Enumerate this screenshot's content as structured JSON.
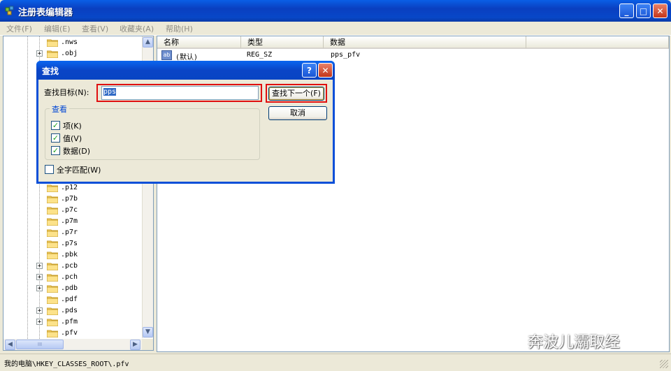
{
  "window": {
    "title": "注册表编辑器"
  },
  "menu": [
    "文件(F)",
    "编辑(E)",
    "查看(V)",
    "收藏夹(A)",
    "帮助(H)"
  ],
  "tree": {
    "top_items": [
      ".nws",
      ".obj"
    ],
    "bottom_items": [
      ".p12",
      ".p7b",
      ".p7c",
      ".p7m",
      ".p7r",
      ".p7s",
      ".pbk",
      ".pcb",
      ".pch",
      ".pdb",
      ".pdf",
      ".pds",
      ".pfm",
      ".pfv"
    ],
    "expandable": [
      ".obj",
      ".pcb",
      ".pch",
      ".pdb",
      ".pds",
      ".pfm"
    ],
    "hscroll_grip": "III"
  },
  "list": {
    "columns": [
      "名称",
      "类型",
      "数据"
    ],
    "rows": [
      {
        "name": "(默认)",
        "type": "REG_SZ",
        "data": "pps_pfv",
        "icon": "string-value-icon"
      }
    ]
  },
  "dialog": {
    "title": "查找",
    "find_label": "查找目标(N):",
    "find_value": "pps",
    "find_next_button": "查找下一个(F)",
    "cancel_button": "取消",
    "look_at_group": "查看",
    "checkboxes": [
      {
        "label": "项(K)",
        "checked": true
      },
      {
        "label": "值(V)",
        "checked": true
      },
      {
        "label": "数据(D)",
        "checked": true
      }
    ],
    "whole_string": {
      "label": "全字匹配(W)",
      "checked": false
    }
  },
  "status": {
    "path": "我的电脑\\HKEY_CLASSES_ROOT\\.pfv"
  },
  "watermark": "奔波儿灞取经",
  "colors": {
    "title_blue": "#0a4fd8",
    "highlight_red": "#e01010",
    "selection": "#316ac5"
  }
}
